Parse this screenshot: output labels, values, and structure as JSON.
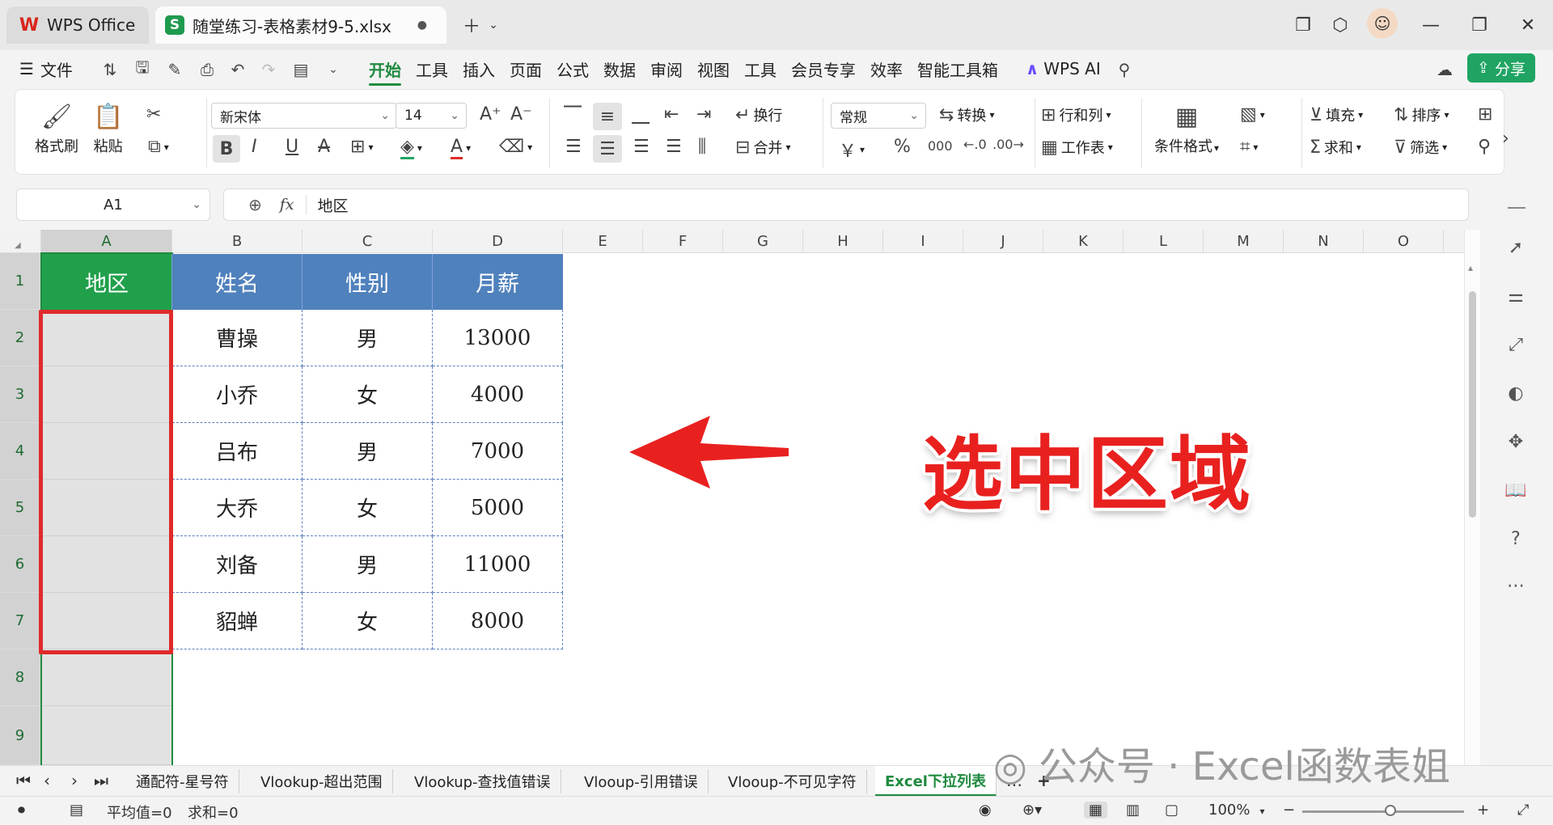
{
  "titlebar": {
    "app_tab": "WPS Office",
    "file_tab": "随堂练习-表格素材9-5.xlsx",
    "file_badge": "S",
    "modified_dot": "●"
  },
  "menubar": {
    "file_label": "文件",
    "tabs": [
      "开始",
      "工具",
      "插入",
      "页面",
      "公式",
      "数据",
      "审阅",
      "视图",
      "工具",
      "会员专享",
      "效率",
      "智能工具箱"
    ],
    "active_tab": "开始",
    "ai_label": "WPS AI",
    "share_label": "分享"
  },
  "ribbon": {
    "format_painter": "格式刷",
    "paste": "粘贴",
    "font_name": "新宋体",
    "font_size": "14",
    "wrap": "换行",
    "merge": "合并",
    "number_format": "常规",
    "convert": "转换",
    "row_col": "行和列",
    "worksheet": "工作表",
    "cond_format": "条件格式",
    "fill": "填充",
    "sort": "排序",
    "sum": "求和",
    "filter": "筛选",
    "currency_symbol": "￥",
    "percent_symbol": "%",
    "thousands_symbol": "000"
  },
  "formula_bar": {
    "name_box": "A1",
    "fx": "fx",
    "value": "地区"
  },
  "sheet": {
    "columns": [
      "A",
      "B",
      "C",
      "D",
      "E",
      "F",
      "G",
      "H",
      "I",
      "J",
      "K",
      "L",
      "M",
      "N",
      "O"
    ],
    "rows": [
      "1",
      "2",
      "3",
      "4",
      "5",
      "6",
      "7",
      "8",
      "9"
    ],
    "selected_column": "A",
    "header_a": "地区",
    "headers": [
      "姓名",
      "性别",
      "月薪"
    ],
    "records": [
      {
        "name": "曹操",
        "gender": "男",
        "salary": "13000"
      },
      {
        "name": "小乔",
        "gender": "女",
        "salary": "4000"
      },
      {
        "name": "吕布",
        "gender": "男",
        "salary": "7000"
      },
      {
        "name": "大乔",
        "gender": "女",
        "salary": "5000"
      },
      {
        "name": "刘备",
        "gender": "男",
        "salary": "11000"
      },
      {
        "name": "貂蝉",
        "gender": "女",
        "salary": "8000"
      }
    ],
    "colors": {
      "header_a_bg": "#20a04b",
      "header_bg": "#4f81bd",
      "annotation_red": "#e8211f"
    }
  },
  "annotation": {
    "text": "选中区域"
  },
  "sheet_tabs": {
    "tabs": [
      "通配符-星号符",
      "Vlookup-超出范围",
      "Vlookup-查找值错误",
      "Vlooup-引用错误",
      "Vlooup-不可见字符",
      "Excel下拉列表"
    ],
    "active": "Excel下拉列表",
    "more": "…",
    "add": "+"
  },
  "watermark": "公众号 · Excel函数表姐",
  "statusbar": {
    "average": "平均值=0",
    "sum": "求和=0",
    "zoom": "100%",
    "zoom_fraction": 0.55
  }
}
